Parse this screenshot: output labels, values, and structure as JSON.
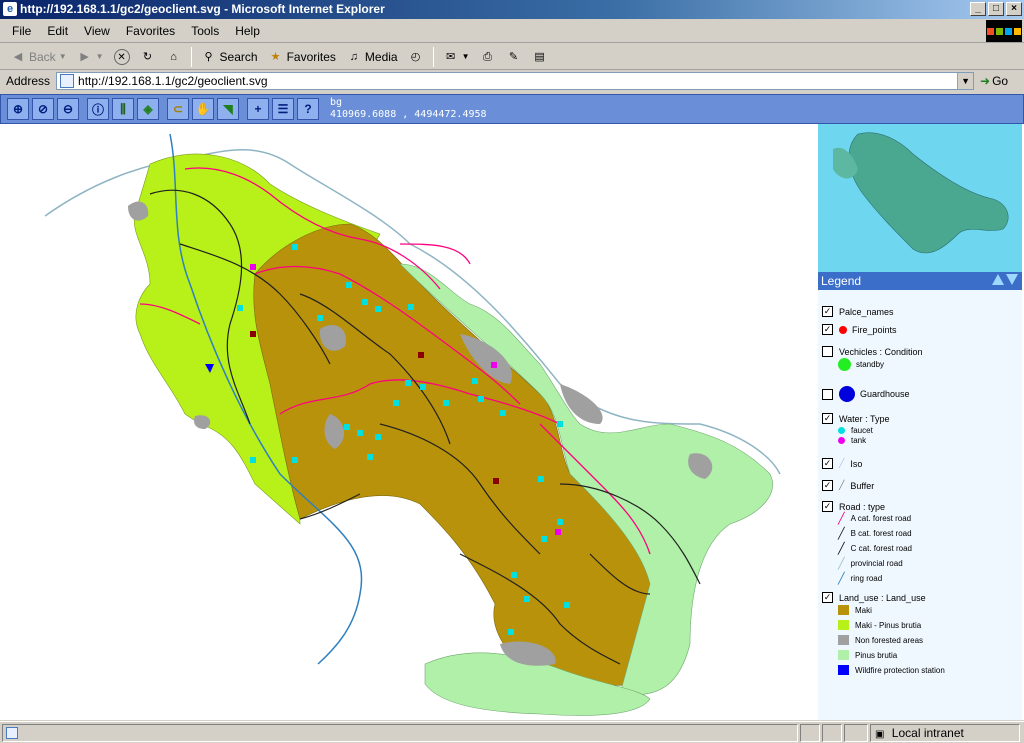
{
  "window": {
    "title": "http://192.168.1.1/gc2/geoclient.svg - Microsoft Internet Explorer",
    "buttons": {
      "minimize": "_",
      "maximize": "□",
      "close": "×"
    }
  },
  "menubar": {
    "items": [
      "File",
      "Edit",
      "View",
      "Favorites",
      "Tools",
      "Help"
    ]
  },
  "toolbar": {
    "back": "Back",
    "search": "Search",
    "favorites": "Favorites",
    "media": "Media"
  },
  "addressbar": {
    "label": "Address",
    "url": "http://192.168.1.1/gc2/geoclient.svg",
    "go": "Go"
  },
  "app": {
    "layer_name": "bg",
    "coordinates": "410969.6088 , 4494472.4958",
    "tools": [
      "zoom-in",
      "zoom-full",
      "zoom-out",
      "info",
      "measure",
      "layers",
      "select",
      "pan-area",
      "pan",
      "add",
      "list",
      "help"
    ]
  },
  "legend": {
    "title": "Legend",
    "items": [
      {
        "label": "Palce_names",
        "checked": true
      },
      {
        "label": "Fire_points",
        "checked": true
      },
      {
        "label": "Vechicles : Condition",
        "checked": false,
        "sub": [
          "standby"
        ]
      },
      {
        "label": "Guardhouse",
        "checked": false
      },
      {
        "label": "Water : Type",
        "checked": true,
        "sub": [
          "faucet",
          "tank"
        ]
      },
      {
        "label": "Iso",
        "checked": true
      },
      {
        "label": "Buffer",
        "checked": true
      },
      {
        "label": "Road : type",
        "checked": true,
        "sub": [
          "A cat. forest road",
          "B cat. forest road",
          "C cat. forest road",
          "provincial road",
          "ring road"
        ]
      },
      {
        "label": "Land_use : Land_use",
        "checked": true,
        "sub": [
          "Maki",
          "Maki - Pinus brutia",
          "Non forested areas",
          "Pinus brutia",
          "Wildfire protection station"
        ]
      }
    ]
  },
  "colors": {
    "maki": "#b8920a",
    "maki_pinus": "#b8f01a",
    "non_forested": "#a0a0a0",
    "pinus": "#b0f0a8",
    "station": "#0000ff",
    "fire": "#ff0000",
    "standby": "#22ee22",
    "guardhouse": "#0000dd",
    "faucet": "#00e0e0",
    "tank": "#ee00ee",
    "road_a": "#ff0080",
    "road_b": "#202020",
    "road_c": "#101010",
    "provincial": "#a0c0d0",
    "ring": "#3080c0"
  },
  "statusbar": {
    "zone": "Local intranet"
  }
}
